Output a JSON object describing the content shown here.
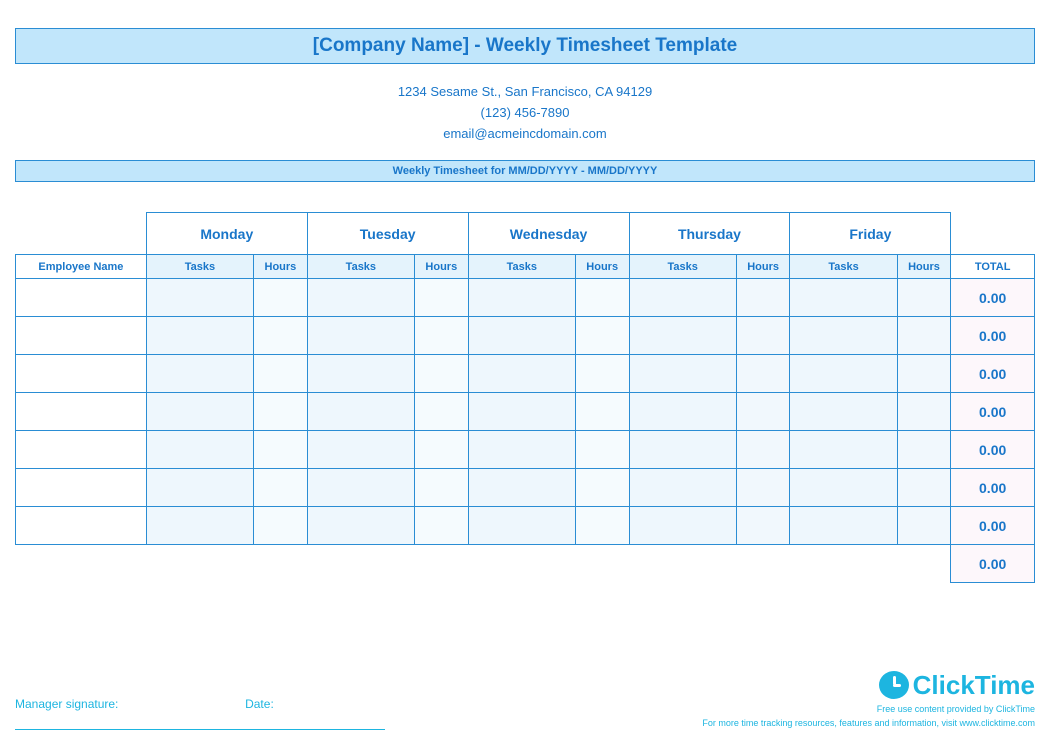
{
  "header": {
    "title": "[Company Name] - Weekly Timesheet Template",
    "address": "1234 Sesame St.,  San Francisco, CA 94129",
    "phone": "(123) 456-7890",
    "email": "email@acmeincdomain.com",
    "subtitle": "Weekly Timesheet for MM/DD/YYYY - MM/DD/YYYY"
  },
  "columns": {
    "employee_name": "Employee Name",
    "days": [
      "Monday",
      "Tuesday",
      "Wednesday",
      "Thursday",
      "Friday"
    ],
    "tasks": "Tasks",
    "hours": "Hours",
    "total": "TOTAL"
  },
  "rows": [
    {
      "total": "0.00"
    },
    {
      "total": "0.00"
    },
    {
      "total": "0.00"
    },
    {
      "total": "0.00"
    },
    {
      "total": "0.00"
    },
    {
      "total": "0.00"
    },
    {
      "total": "0.00"
    }
  ],
  "grand_total": "0.00",
  "footer": {
    "signature_label": "Manager signature:",
    "date_label": "Date:",
    "brand_name": "ClickTime",
    "tagline1": "Free use content provided by ClickTime",
    "tagline2": "For more time tracking resources, features and information, visit www.clicktime.com"
  }
}
